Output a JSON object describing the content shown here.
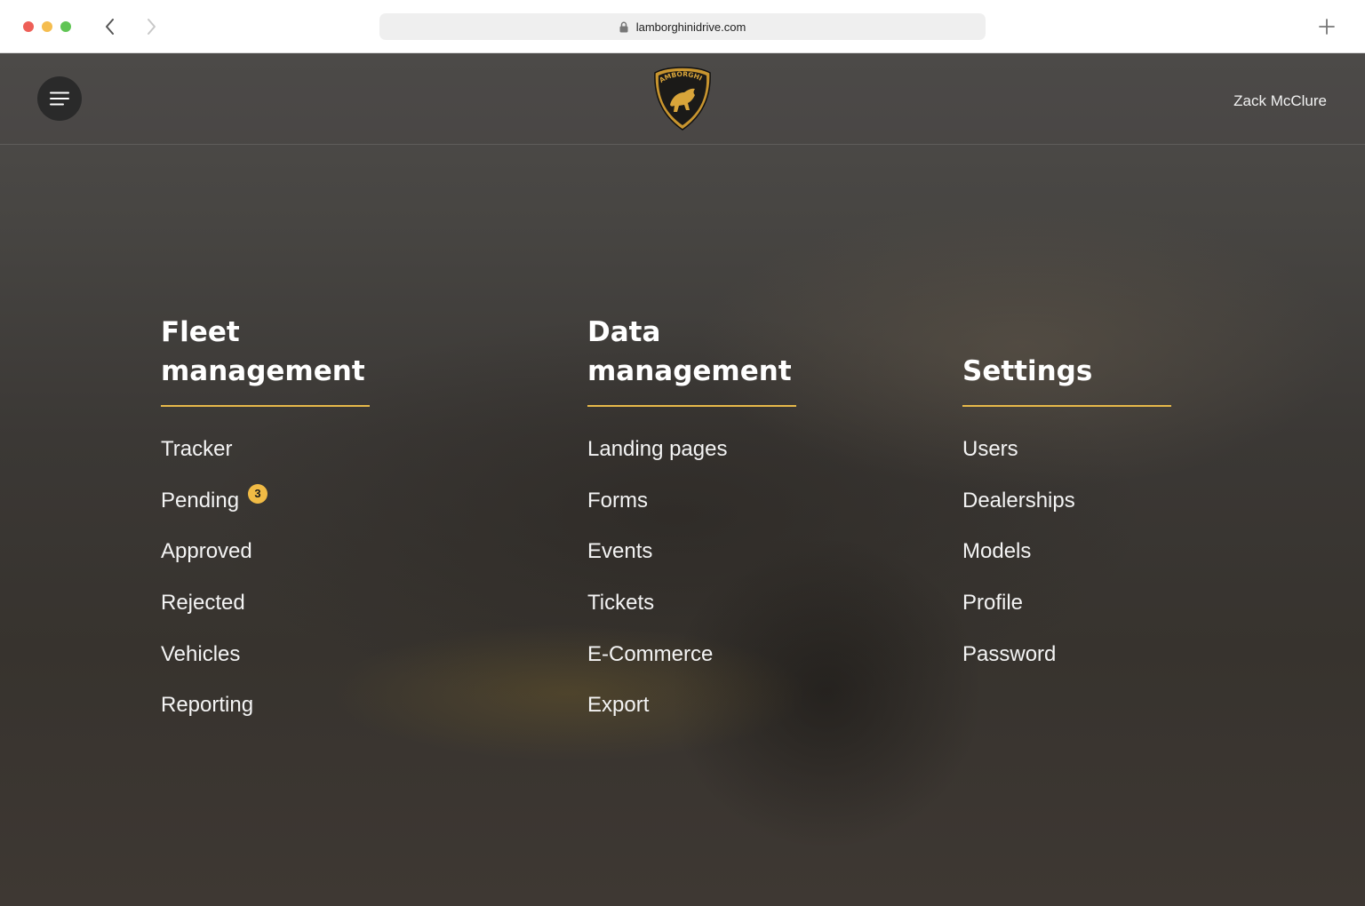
{
  "browser": {
    "url": "lamborghinidrive.com"
  },
  "header": {
    "user_name": "Zack McClure",
    "logo_text": "LAMBORGHINI"
  },
  "colors": {
    "accent": "#e7b94a",
    "badge": "#f1bb45"
  },
  "columns": [
    {
      "title_line1": "Fleet",
      "title_line2": "management",
      "items": [
        "Tracker",
        "Pending",
        "Approved",
        "Rejected",
        "Vehicles",
        "Reporting"
      ],
      "pending_badge": "3"
    },
    {
      "title_line1": "Data",
      "title_line2": "management",
      "items": [
        "Landing pages",
        "Forms",
        "Events",
        "Tickets",
        "E-Commerce",
        "Export"
      ]
    },
    {
      "title_line1": "",
      "title_line2": "Settings",
      "items": [
        "Users",
        "Dealerships",
        "Models",
        "Profile",
        "Password"
      ]
    }
  ]
}
